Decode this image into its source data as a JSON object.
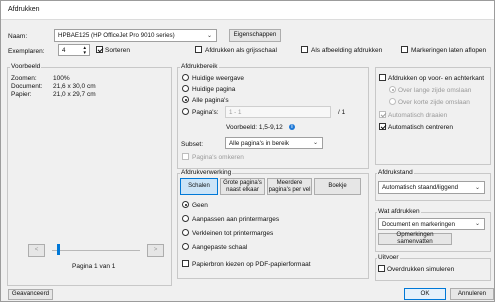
{
  "window": {
    "title": "Afdrukken"
  },
  "printer": {
    "name_label": "Naam:",
    "name_value": "HPBAE125 (HP OfficeJet Pro 9010 series)",
    "properties_button": "Eigenschappen",
    "copies_label": "Exemplaren:",
    "copies_value": "4",
    "collate_label": "Sorteren",
    "grayscale_label": "Afdrukken als grijsschaal",
    "as_image_label": "Als afbeelding afdrukken",
    "markup_label": "Markeringen laten aflopen"
  },
  "preview": {
    "group_label": "Voorbeeld",
    "zoom_label": "Zoomen:",
    "zoom_value": "100%",
    "document_label": "Document:",
    "document_value": "21,6 x 30,0 cm",
    "paper_label": "Papier:",
    "paper_value": "21,0 x 29,7 cm",
    "page_indicator": "Pagina 1 van 1",
    "prev_label": "<",
    "next_label": ">"
  },
  "print_range": {
    "group_label": "Afdrukbereik",
    "current_view": "Huidige weergave",
    "current_page": "Huidige pagina",
    "all_pages": "Alle pagina's",
    "pages_label": "Pagina's:",
    "pages_placeholder": "1 - 1",
    "pages_total": "/ 1",
    "example_label": "Voorbeeld: 1,5-9,12",
    "subset_label": "Subset:",
    "subset_value": "Alle pagina's in bereik",
    "reverse_label": "Pagina's omkeren"
  },
  "page_handling": {
    "group_label": "Afdrukverwerking",
    "tabs": [
      {
        "label": "Schalen"
      },
      {
        "label": "Grote pagina's naast elkaar"
      },
      {
        "label": "Meerdere pagina's per vel"
      },
      {
        "label": "Boekje"
      }
    ],
    "none_label": "Geen",
    "fit_label": "Aanpassen aan printermarges",
    "shrink_label": "Verkleinen tot printermarges",
    "custom_label": "Aangepaste schaal",
    "paper_source_label": "Papierbron kiezen op PDF-papierformaat"
  },
  "duplex": {
    "print_both_label": "Afdrukken op voor- en achterkant",
    "long_edge_label": "Over lange zijde omslaan",
    "short_edge_label": "Over korte zijde omslaan",
    "auto_rotate_label": "Automatisch draaien",
    "auto_center_label": "Automatisch centreren"
  },
  "orientation": {
    "group_label": "Afdrukstand",
    "value": "Automatisch staand/liggend"
  },
  "what_to_print": {
    "group_label": "Wat afdrukken",
    "value": "Document en markeringen",
    "summarize_button": "Opmerkingen samenvatten"
  },
  "output": {
    "group_label": "Uitvoer",
    "simulate_overprint_label": "Overdrukken simuleren"
  },
  "footer": {
    "advanced_button": "Geavanceerd",
    "ok_button": "OK",
    "cancel_button": "Annuleren"
  },
  "icons": {
    "dropdown": "chevron-down-icon",
    "spinner": "spin-updown-icon",
    "help": "help-icon"
  }
}
